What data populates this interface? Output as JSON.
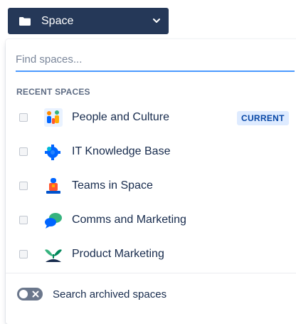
{
  "space_button": {
    "label": "Space"
  },
  "search": {
    "placeholder": "Find spaces..."
  },
  "section_title": "RECENT SPACES",
  "spaces": [
    {
      "name": "People and Culture",
      "icon": "people-and-culture-icon",
      "badge": "CURRENT"
    },
    {
      "name": "IT Knowledge Base",
      "icon": "gear-icon"
    },
    {
      "name": "Teams in Space",
      "icon": "astronaut-icon"
    },
    {
      "name": "Comms and Marketing",
      "icon": "speech-bubble-icon"
    },
    {
      "name": "Product Marketing",
      "icon": "sprout-icon"
    }
  ],
  "archived": {
    "label": "Search archived spaces",
    "enabled": false
  },
  "colors": {
    "button_bg": "#253858",
    "accent": "#4c9aff",
    "badge_bg": "#deebff",
    "badge_text": "#0747a6"
  }
}
